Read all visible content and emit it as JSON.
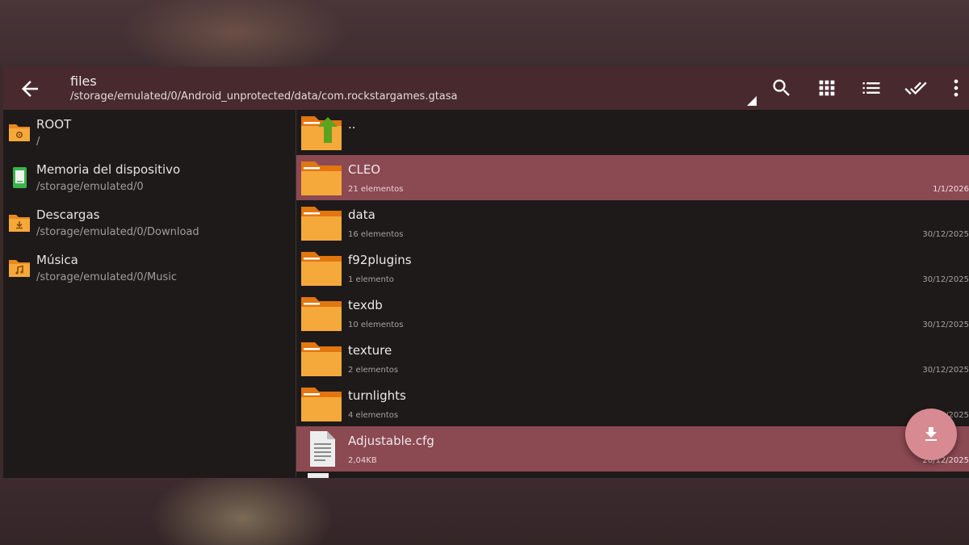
{
  "toolbar": {
    "title": "files",
    "path": "/storage/emulated/0/Android_unprotected/data/com.rockstargames.gtasa",
    "icons": [
      "back-arrow-icon",
      "search-icon",
      "grid-view-icon",
      "list-view-icon",
      "select-all-icon",
      "more-vert-icon"
    ]
  },
  "bookmarks": [
    {
      "name": "ROOT",
      "path": "/",
      "icon": "root-folder-icon"
    },
    {
      "name": "Memoria del dispositivo",
      "path": "/storage/emulated/0",
      "icon": "device-storage-icon"
    },
    {
      "name": "Descargas",
      "path": "/storage/emulated/0/Download",
      "icon": "download-folder-icon"
    },
    {
      "name": "Música",
      "path": "/storage/emulated/0/Music",
      "icon": "music-folder-icon"
    }
  ],
  "files": [
    {
      "name": "..",
      "meta": "",
      "date": "",
      "type": "parent",
      "selected": false
    },
    {
      "name": "CLEO",
      "meta": "21 elementos",
      "date": "1/1/2026",
      "type": "folder",
      "selected": true
    },
    {
      "name": "data",
      "meta": "16 elementos",
      "date": "30/12/2025",
      "type": "folder",
      "selected": false
    },
    {
      "name": "f92plugins",
      "meta": "1 elemento",
      "date": "30/12/2025",
      "type": "folder",
      "selected": false
    },
    {
      "name": "texdb",
      "meta": "10 elementos",
      "date": "30/12/2025",
      "type": "folder",
      "selected": false
    },
    {
      "name": "texture",
      "meta": "2 elementos",
      "date": "30/12/2025",
      "type": "folder",
      "selected": false
    },
    {
      "name": "turnlights",
      "meta": "4 elementos",
      "date": "30/12/2025",
      "type": "folder",
      "selected": false
    },
    {
      "name": "Adjustable.cfg",
      "meta": "2,04KB",
      "date": "20/12/2025",
      "type": "file",
      "selected": true
    }
  ],
  "fab": {
    "icon": "download-icon"
  },
  "colors": {
    "toolbar": "#482a2e",
    "background": "#1e1a1a",
    "selected": "#8b4952",
    "folder": "#f6a93b",
    "fab": "#d88a92"
  }
}
